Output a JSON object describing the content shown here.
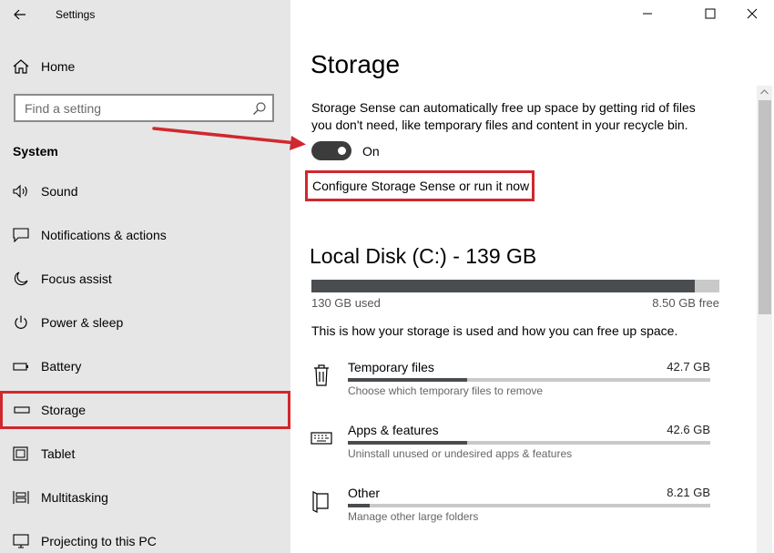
{
  "window": {
    "title": "Settings"
  },
  "sidebar": {
    "home_label": "Home",
    "search_placeholder": "Find a setting",
    "section_label": "System",
    "items": [
      {
        "label": "Sound",
        "icon": "speaker-icon"
      },
      {
        "label": "Notifications & actions",
        "icon": "notification-icon"
      },
      {
        "label": "Focus assist",
        "icon": "moon-icon"
      },
      {
        "label": "Power & sleep",
        "icon": "power-icon"
      },
      {
        "label": "Battery",
        "icon": "battery-icon"
      },
      {
        "label": "Storage",
        "icon": "storage-icon",
        "active": true
      },
      {
        "label": "Tablet",
        "icon": "tablet-icon"
      },
      {
        "label": "Multitasking",
        "icon": "multitasking-icon"
      },
      {
        "label": "Projecting to this PC",
        "icon": "projecting-icon"
      }
    ]
  },
  "main": {
    "title": "Storage",
    "description": "Storage Sense can automatically free up space by getting rid of files you don't need, like temporary files and content in your recycle bin.",
    "toggle_label": "On",
    "toggle_on": true,
    "configure_link": "Configure Storage Sense or run it now",
    "disk": {
      "title": "Local Disk (C:) - 139 GB",
      "used": "130 GB used",
      "free": "8.50 GB free",
      "used_fraction": 0.94
    },
    "usage_note": "This is how your storage is used and how you can free up space.",
    "categories": [
      {
        "name": "Temporary files",
        "size": "42.7 GB",
        "sub": "Choose which temporary files to remove",
        "fraction": 0.33,
        "icon": "trash-icon"
      },
      {
        "name": "Apps & features",
        "size": "42.6 GB",
        "sub": "Uninstall unused or undesired apps & features",
        "fraction": 0.33,
        "icon": "keyboard-icon"
      },
      {
        "name": "Other",
        "size": "8.21 GB",
        "sub": "Manage other large folders",
        "fraction": 0.06,
        "icon": "folder-icon"
      }
    ]
  },
  "colors": {
    "sidebar_bg": "#e6e6e6",
    "highlight": "#d0282e",
    "bar_fill": "#4a4d50",
    "bar_track": "#c9c9c9"
  }
}
